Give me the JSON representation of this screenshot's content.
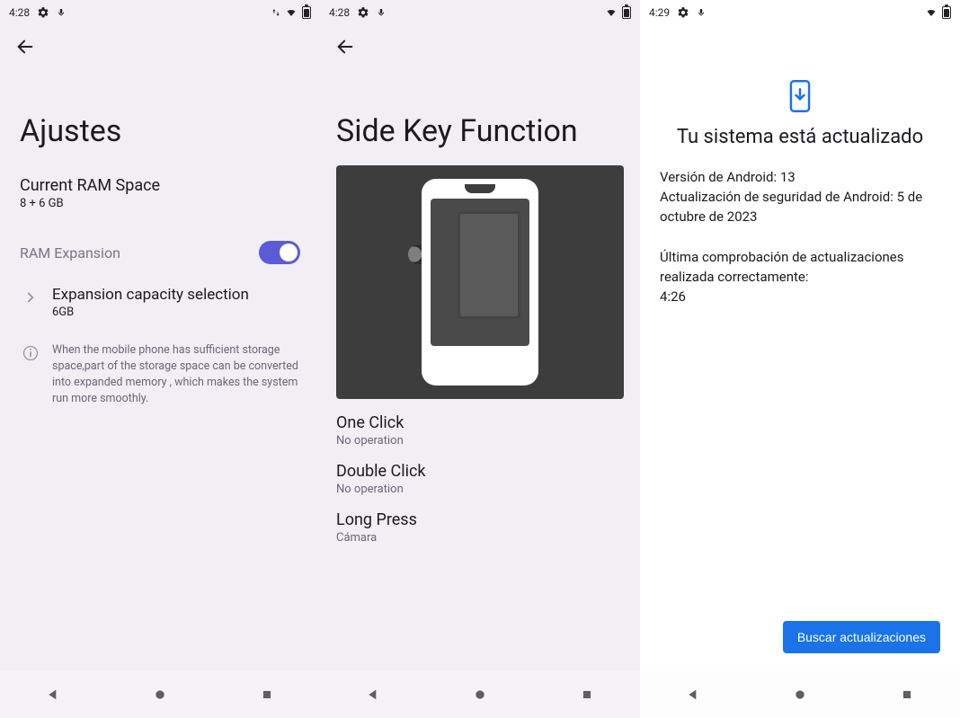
{
  "screen1": {
    "status": {
      "time": "4:28"
    },
    "title": "Ajustes",
    "ram_label": "Current RAM Space",
    "ram_value": "8 + 6 GB",
    "expansion_label": "RAM Expansion",
    "expansion_on": true,
    "capacity_title": "Expansion capacity selection",
    "capacity_value": "6GB",
    "info_text": "When the mobile phone has sufficient storage space,part of the storage space can be converted into expanded memory , which makes the system run more smoothly."
  },
  "screen2": {
    "status": {
      "time": "4:28"
    },
    "title": "Side Key Function",
    "options": [
      {
        "title": "One Click",
        "value": "No operation"
      },
      {
        "title": "Double Click",
        "value": "No operation"
      },
      {
        "title": "Long Press",
        "value": "Cámara"
      }
    ]
  },
  "screen3": {
    "status": {
      "time": "4:29"
    },
    "title": "Tu sistema está actualizado",
    "line1": "Versión de Android: 13",
    "line2": "Actualización de seguridad de Android: 5 de octubre de 2023",
    "line3": "Última comprobación de actualizaciones realizada correctamente:",
    "line4": "4:26",
    "button": "Buscar actualizaciones"
  },
  "icons": {
    "gear": "gear-icon",
    "mic": "mic-icon",
    "wifi": "wifi-icon",
    "battery": "battery-icon",
    "updown": "updown-icon",
    "back": "back-icon",
    "chevron": "chevron-right-icon",
    "info": "info-icon",
    "update": "system-update-icon",
    "nav_back": "nav-back-icon",
    "nav_home": "nav-home-icon",
    "nav_recent": "nav-recent-icon"
  },
  "colors": {
    "accent_switch": "#5b5bd6",
    "accent_btn": "#1a73e8"
  }
}
